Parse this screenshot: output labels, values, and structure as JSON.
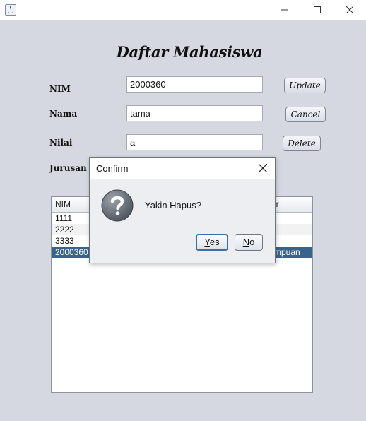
{
  "window": {
    "icon": "java-coffee-cup-icon",
    "controls": [
      "minimize-icon",
      "maximize-icon",
      "close-icon"
    ]
  },
  "form": {
    "heading": "Daftar Mahasiswa",
    "labels": {
      "nim": "NIM",
      "nama": "Nama",
      "nilai": "Nilai",
      "jurusan": "Jurusan"
    },
    "values": {
      "nim": "2000360",
      "nama": "tama",
      "nilai": "a"
    },
    "buttons": {
      "update": "Update",
      "cancel": "Cancel",
      "delete": "Delete"
    }
  },
  "table": {
    "headers": [
      "NIM",
      "er"
    ],
    "rows": [
      {
        "nim": "1111",
        "last": ""
      },
      {
        "nim": "2222",
        "last": ""
      },
      {
        "nim": "3333",
        "last": ""
      },
      {
        "nim": "2000360",
        "last": "mpuan",
        "selected": true
      }
    ]
  },
  "dialog": {
    "title": "Confirm",
    "message": "Yakin Hapus?",
    "icon": "question-icon",
    "yes_mnemonic": "Y",
    "yes_rest": "es",
    "no_mnemonic": "N",
    "no_rest": "o"
  },
  "colors": {
    "background": "#d5d8e0",
    "selection": "#39638a",
    "focus": "#3d6fa8"
  }
}
